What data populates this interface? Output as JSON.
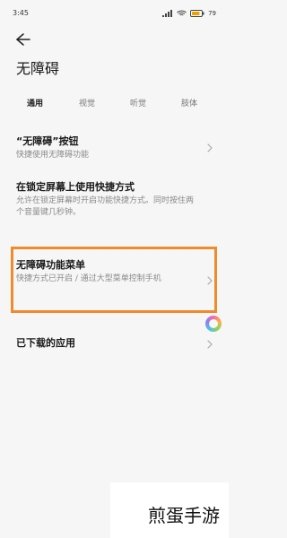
{
  "status_bar": {
    "time": "3:45",
    "battery_text": "79"
  },
  "header": {
    "title": "无障碍"
  },
  "tabs": [
    {
      "label": "通用",
      "active": true
    },
    {
      "label": "视觉",
      "active": false
    },
    {
      "label": "听觉",
      "active": false
    },
    {
      "label": "肢体",
      "active": false
    }
  ],
  "settings": [
    {
      "title": "“无障碍”按钮",
      "description": "快捷使用无障碍功能"
    },
    {
      "title": "在锁定屏幕上使用快捷方式",
      "description": "允许在锁定屏幕时开启功能快捷方式。同时按住两个音量键几秒钟。"
    },
    {
      "title": "无障碍功能菜单",
      "description": "快捷方式已开启 / 通过大型菜单控制手机"
    },
    {
      "title": "已下载的应用"
    }
  ],
  "highlight": {
    "color": "#f08a2a"
  },
  "watermark": {
    "text": "煎蛋手游"
  }
}
